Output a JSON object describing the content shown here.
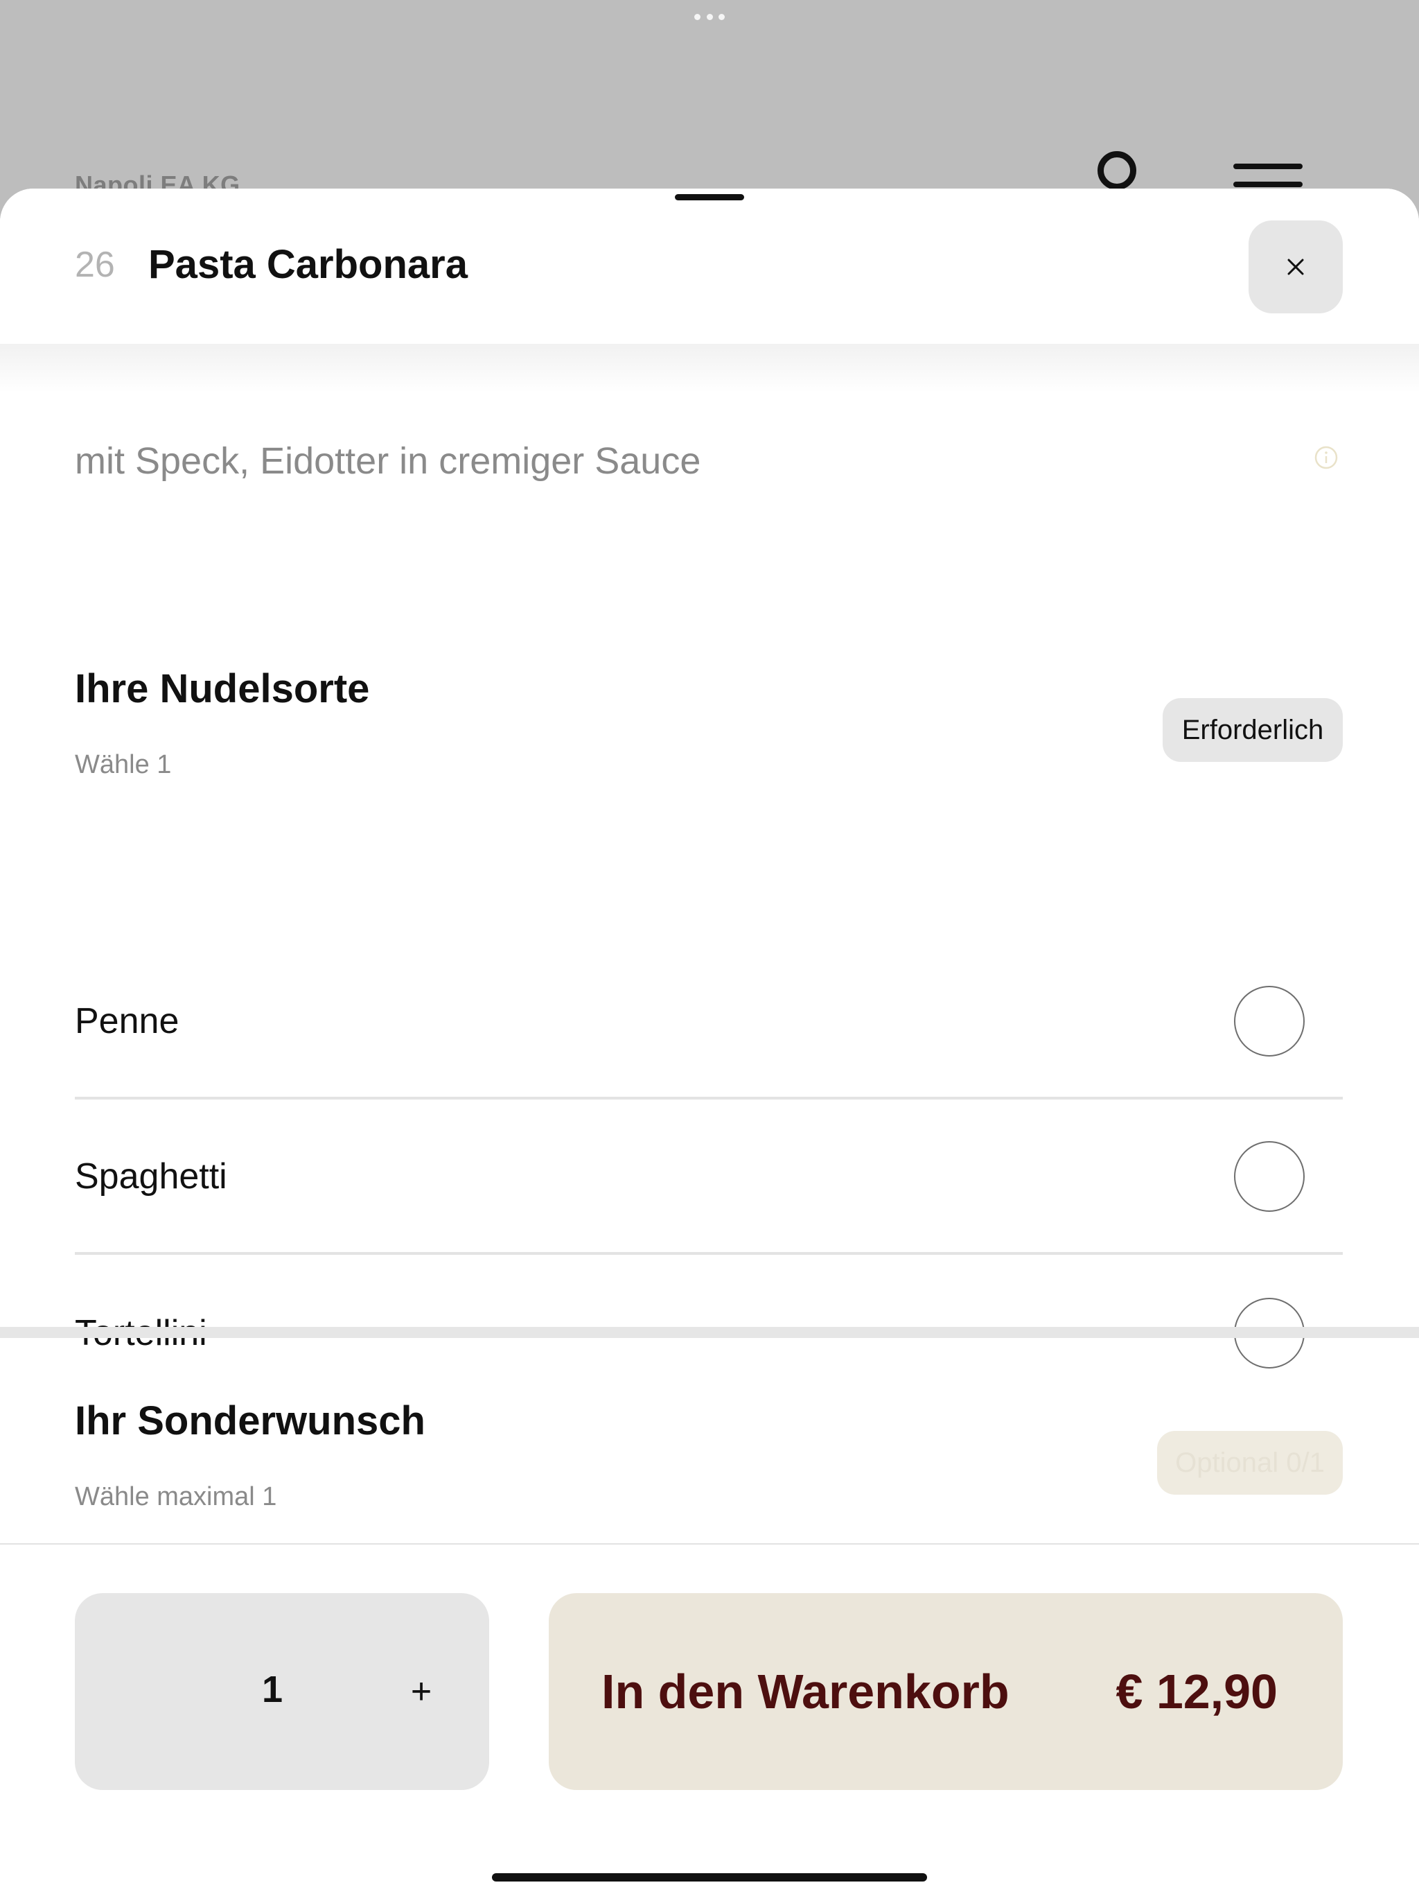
{
  "background": {
    "brand_name": "Napoli EA KG"
  },
  "item": {
    "number": "26",
    "title": "Pasta Carbonara",
    "description": "mit Speck, Eidotter in cremiger Sauce"
  },
  "groups": [
    {
      "title": "Ihre Nudelsorte",
      "hint": "Wähle 1",
      "badge": "Erforderlich",
      "options": [
        {
          "label": "Penne",
          "selected": false
        },
        {
          "label": "Spaghetti",
          "selected": false
        },
        {
          "label": "Tortellini",
          "selected": false
        }
      ]
    },
    {
      "title": "Ihr Sonderwunsch",
      "hint": "Wähle maximal 1",
      "badge": "Optional 0/1"
    }
  ],
  "footer": {
    "quantity": "1",
    "plus_label": "+",
    "add_to_cart_label": "In den Warenkorb",
    "price": "€ 12,90"
  },
  "colors": {
    "accent_text": "#4d0f0f",
    "accent_background": "#ebe6da",
    "neutral_button": "#e6e6e6"
  },
  "icons": {
    "close": "close-icon",
    "info": "info-icon",
    "account": "account-icon",
    "menu": "menu-icon"
  }
}
